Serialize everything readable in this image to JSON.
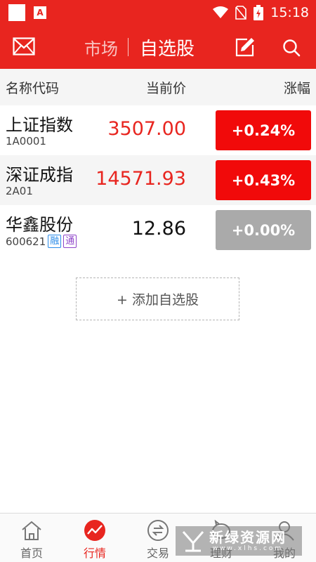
{
  "status_bar": {
    "time": "15:18",
    "app_badge": "A"
  },
  "header": {
    "tab_market": "市场",
    "tab_watchlist": "自选股"
  },
  "columns": {
    "name_code": "名称代码",
    "price": "当前价",
    "change": "涨幅"
  },
  "stocks": [
    {
      "name": "上证指数",
      "code": "1A0001",
      "price": "3507.00",
      "change": "+0.24%",
      "price_color": "#e8251f",
      "badge_color": "#f10a0a"
    },
    {
      "name": "深证成指",
      "code": "2A01",
      "price": "14571.93",
      "change": "+0.43%",
      "price_color": "#e8251f",
      "badge_color": "#f10a0a"
    },
    {
      "name": "华鑫股份",
      "code": "600621",
      "price": "12.86",
      "change": "+0.00%",
      "price_color": "#111111",
      "badge_color": "#aaaaaa",
      "tags": [
        "融",
        "通"
      ]
    }
  ],
  "add_button": "+ 添加自选股",
  "bottom_nav": [
    {
      "label": "首页",
      "icon": "home-icon",
      "active": false
    },
    {
      "label": "行情",
      "icon": "market-chart-icon",
      "active": true
    },
    {
      "label": "交易",
      "icon": "trade-icon",
      "active": false
    },
    {
      "label": "理财",
      "icon": "piggy-bank-icon",
      "active": false
    },
    {
      "label": "我的",
      "icon": "user-icon",
      "active": false
    }
  ],
  "watermark": {
    "title": "新绿资源网",
    "subtitle": "www.xlhs.com"
  },
  "colors": {
    "brand_red": "#e8251f",
    "up_red": "#f10a0a",
    "flat_gray": "#aaaaaa"
  }
}
